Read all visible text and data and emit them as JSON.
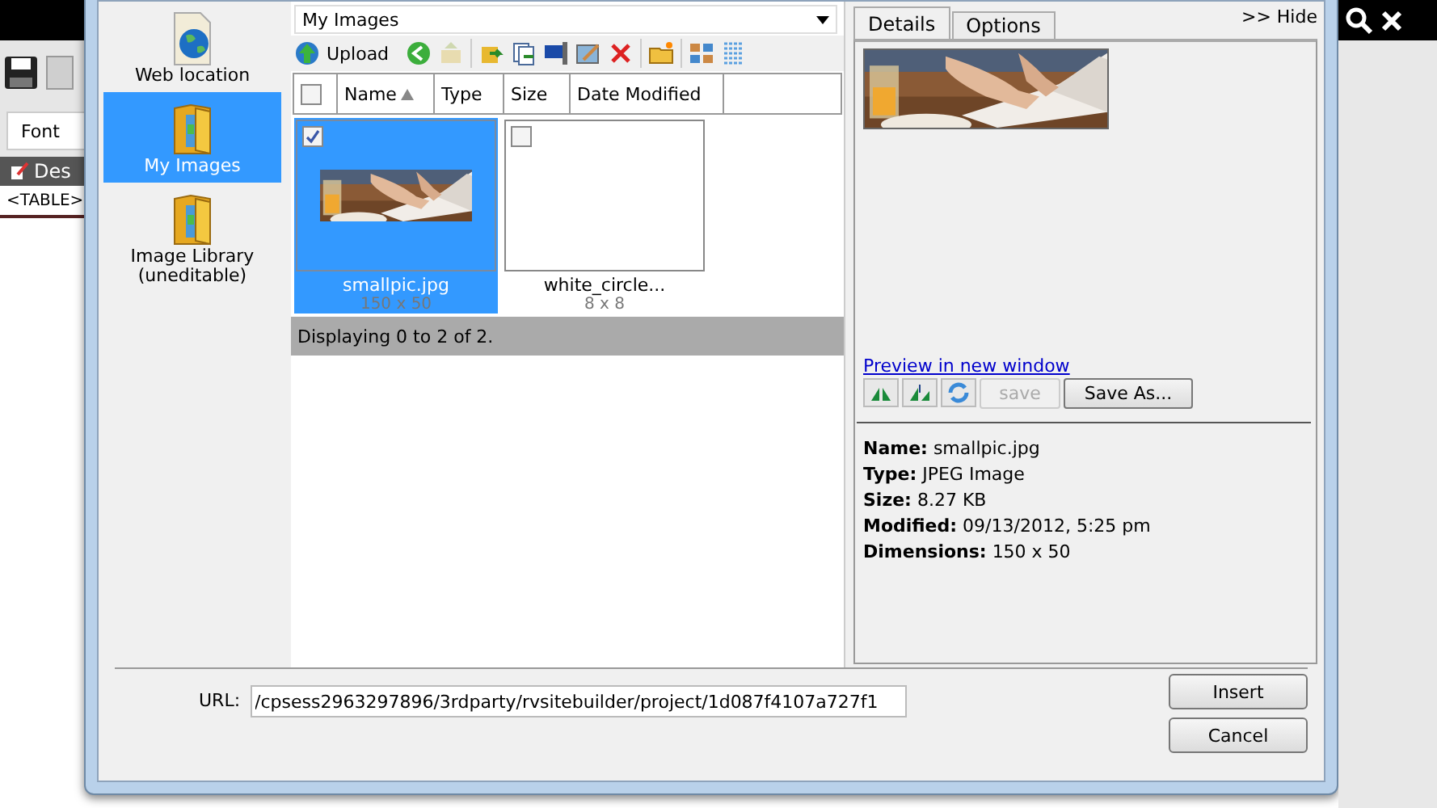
{
  "background_app": {
    "font_field": "Font",
    "tab": "Des",
    "breadcrumb": "<TABLE>"
  },
  "sidebar": {
    "items": [
      {
        "label": "Web location",
        "selected": false,
        "kind": "web"
      },
      {
        "label": "My Images",
        "selected": true,
        "kind": "folder"
      },
      {
        "label": "Image Library (uneditable)",
        "selected": false,
        "kind": "folder"
      }
    ]
  },
  "folder_select": {
    "value": "My Images"
  },
  "toolbar": {
    "upload": "Upload"
  },
  "columns": [
    {
      "label": "Name",
      "sorted": true
    },
    {
      "label": "Type",
      "sorted": false
    },
    {
      "label": "Size",
      "sorted": false
    },
    {
      "label": "Date Modified",
      "sorted": false
    }
  ],
  "select_all": {
    "checked": false
  },
  "files": [
    {
      "name": "smallpic.jpg",
      "dims": "150 x 50",
      "selected": true,
      "checked": true,
      "kind": "picture"
    },
    {
      "name": "white_circle...",
      "dims": "8 x 8",
      "selected": false,
      "checked": false,
      "kind": "blank"
    }
  ],
  "status": "Displaying 0 to 2 of 2.",
  "details": {
    "tabs": [
      {
        "label": "Details",
        "selected": true
      },
      {
        "label": "Options",
        "selected": false
      }
    ],
    "hide": ">> Hide",
    "preview_link": "Preview in new window",
    "buttons": [
      {
        "label": "save",
        "disabled": true
      },
      {
        "label": "Save As...",
        "disabled": false
      }
    ],
    "info": [
      {
        "label": "Name:",
        "value": "smallpic.jpg"
      },
      {
        "label": "Type:",
        "value": "JPEG Image"
      },
      {
        "label": "Size:",
        "value": "8.27 KB"
      },
      {
        "label": "Modified:",
        "value": "09/13/2012, 5:25 pm"
      },
      {
        "label": "Dimensions:",
        "value": "150 x 50"
      }
    ]
  },
  "url": {
    "label": "URL:",
    "value": "/cpsess2963297896/3rdparty/rvsitebuilder/project/1d087f4107a727f1"
  },
  "buttons": [
    {
      "label": "Insert"
    },
    {
      "label": "Cancel"
    }
  ]
}
